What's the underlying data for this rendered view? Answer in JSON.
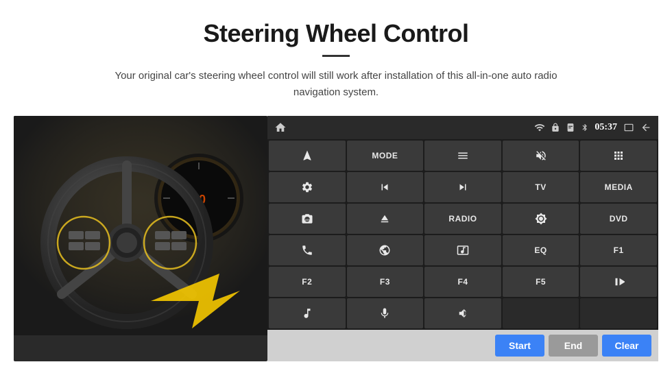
{
  "header": {
    "title": "Steering Wheel Control",
    "subtitle": "Your original car's steering wheel control will still work after installation of this all-in-one auto radio navigation system.",
    "divider": true
  },
  "status_bar": {
    "home_icon": "home",
    "wifi_icon": "wifi",
    "lock_icon": "lock",
    "sim_icon": "sim",
    "bt_icon": "bluetooth",
    "time": "05:37",
    "screen_icon": "screen",
    "back_icon": "back"
  },
  "buttons": [
    {
      "id": "nav",
      "type": "icon",
      "icon": "navigate",
      "row": 1,
      "col": 1
    },
    {
      "id": "mode",
      "type": "text",
      "label": "MODE",
      "row": 1,
      "col": 2
    },
    {
      "id": "menu",
      "type": "icon",
      "icon": "menu",
      "row": 1,
      "col": 3
    },
    {
      "id": "mute",
      "type": "icon",
      "icon": "mute",
      "row": 1,
      "col": 4
    },
    {
      "id": "apps",
      "type": "icon",
      "icon": "apps",
      "row": 1,
      "col": 5
    },
    {
      "id": "settings",
      "type": "icon",
      "icon": "settings",
      "row": 2,
      "col": 1
    },
    {
      "id": "prev",
      "type": "icon",
      "icon": "prev",
      "row": 2,
      "col": 2
    },
    {
      "id": "next",
      "type": "icon",
      "icon": "next",
      "row": 2,
      "col": 3
    },
    {
      "id": "tv",
      "type": "text",
      "label": "TV",
      "row": 2,
      "col": 4
    },
    {
      "id": "media",
      "type": "text",
      "label": "MEDIA",
      "row": 2,
      "col": 5
    },
    {
      "id": "camera360",
      "type": "icon",
      "icon": "camera360",
      "row": 3,
      "col": 1
    },
    {
      "id": "eject",
      "type": "icon",
      "icon": "eject",
      "row": 3,
      "col": 2
    },
    {
      "id": "radio",
      "type": "text",
      "label": "RADIO",
      "row": 3,
      "col": 3
    },
    {
      "id": "brightness",
      "type": "icon",
      "icon": "brightness",
      "row": 3,
      "col": 4
    },
    {
      "id": "dvd",
      "type": "text",
      "label": "DVD",
      "row": 3,
      "col": 5
    },
    {
      "id": "phone",
      "type": "icon",
      "icon": "phone",
      "row": 4,
      "col": 1
    },
    {
      "id": "browse",
      "type": "icon",
      "icon": "globe",
      "row": 4,
      "col": 2
    },
    {
      "id": "screen",
      "type": "icon",
      "icon": "screen2",
      "row": 4,
      "col": 3
    },
    {
      "id": "eq",
      "type": "text",
      "label": "EQ",
      "row": 4,
      "col": 4
    },
    {
      "id": "f1",
      "type": "text",
      "label": "F1",
      "row": 4,
      "col": 5
    },
    {
      "id": "f2",
      "type": "text",
      "label": "F2",
      "row": 5,
      "col": 1
    },
    {
      "id": "f3",
      "type": "text",
      "label": "F3",
      "row": 5,
      "col": 2
    },
    {
      "id": "f4",
      "type": "text",
      "label": "F4",
      "row": 5,
      "col": 3
    },
    {
      "id": "f5",
      "type": "text",
      "label": "F5",
      "row": 5,
      "col": 4
    },
    {
      "id": "playpause",
      "type": "icon",
      "icon": "playpause",
      "row": 5,
      "col": 5
    },
    {
      "id": "music",
      "type": "icon",
      "icon": "music",
      "row": 6,
      "col": 1
    },
    {
      "id": "mic",
      "type": "icon",
      "icon": "mic",
      "row": 6,
      "col": 2
    },
    {
      "id": "vol",
      "type": "icon",
      "icon": "vol",
      "row": 6,
      "col": 3
    },
    {
      "id": "empty1",
      "type": "empty",
      "row": 6,
      "col": 4
    },
    {
      "id": "empty2",
      "type": "empty",
      "row": 6,
      "col": 5
    }
  ],
  "action_bar": {
    "start_label": "Start",
    "end_label": "End",
    "clear_label": "Clear"
  }
}
